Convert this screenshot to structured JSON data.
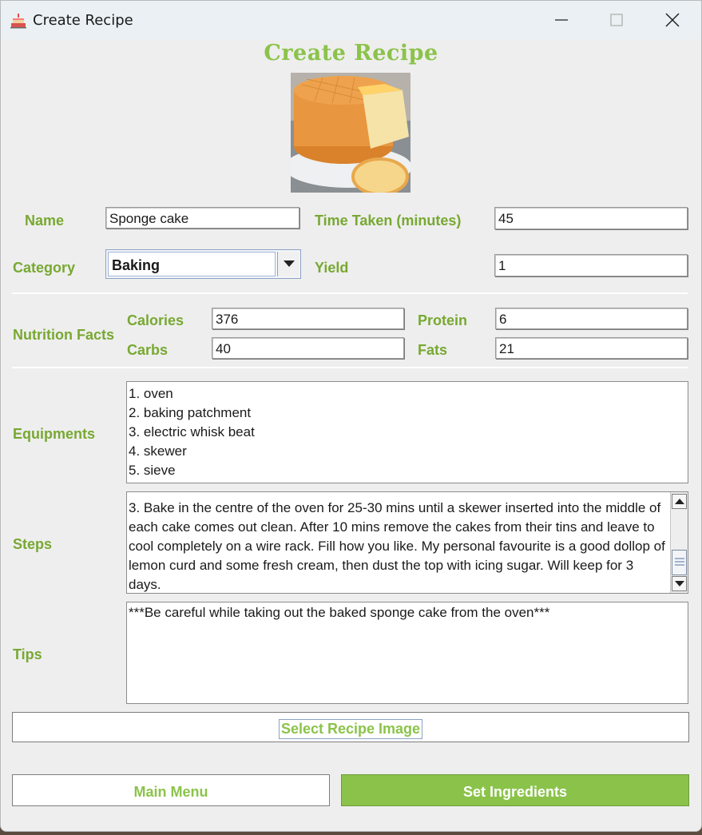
{
  "window": {
    "title": "Create Recipe",
    "controls": [
      "minimize-icon",
      "maximize-icon",
      "close-icon"
    ]
  },
  "header": {
    "heading": "Create Recipe",
    "image": "sponge-cake-photo"
  },
  "form": {
    "name_label": "Name",
    "name_value": "Sponge cake",
    "time_label": "Time Taken (minutes)",
    "time_value": "45",
    "category_label": "Category",
    "category_value": "Baking",
    "yield_label": "Yield",
    "yield_value": "1"
  },
  "nutrition": {
    "section_label": "Nutrition Facts",
    "calories_label": "Calories",
    "calories_value": "376",
    "protein_label": "Protein",
    "protein_value": "6",
    "carbs_label": "Carbs",
    "carbs_value": "40",
    "fats_label": "Fats",
    "fats_value": "21"
  },
  "equipments": {
    "label": "Equipments",
    "lines": [
      "1. oven",
      "2. baking patchment",
      "3. electric whisk beat",
      "4. skewer",
      "5. sieve"
    ]
  },
  "steps": {
    "label": "Steps",
    "text": "3. Bake in the centre of the oven for 25-30 mins until a skewer inserted into the middle of each cake comes out clean. After 10 mins remove the cakes from their tins and leave to cool completely on a wire rack. Fill how you like. My personal favourite is a good dollop of lemon curd and some fresh cream, then dust the top with icing sugar. Will keep for 3 days."
  },
  "tips": {
    "label": "Tips",
    "text": "***Be careful while taking out the baked sponge cake from the oven***"
  },
  "buttons": {
    "select_image": "Select Recipe Image",
    "main_menu": "Main Menu",
    "set_ingredients": "Set Ingredients"
  },
  "colors": {
    "accent": "#8bc34a",
    "label": "#78a832",
    "background": "#eeeeee"
  }
}
